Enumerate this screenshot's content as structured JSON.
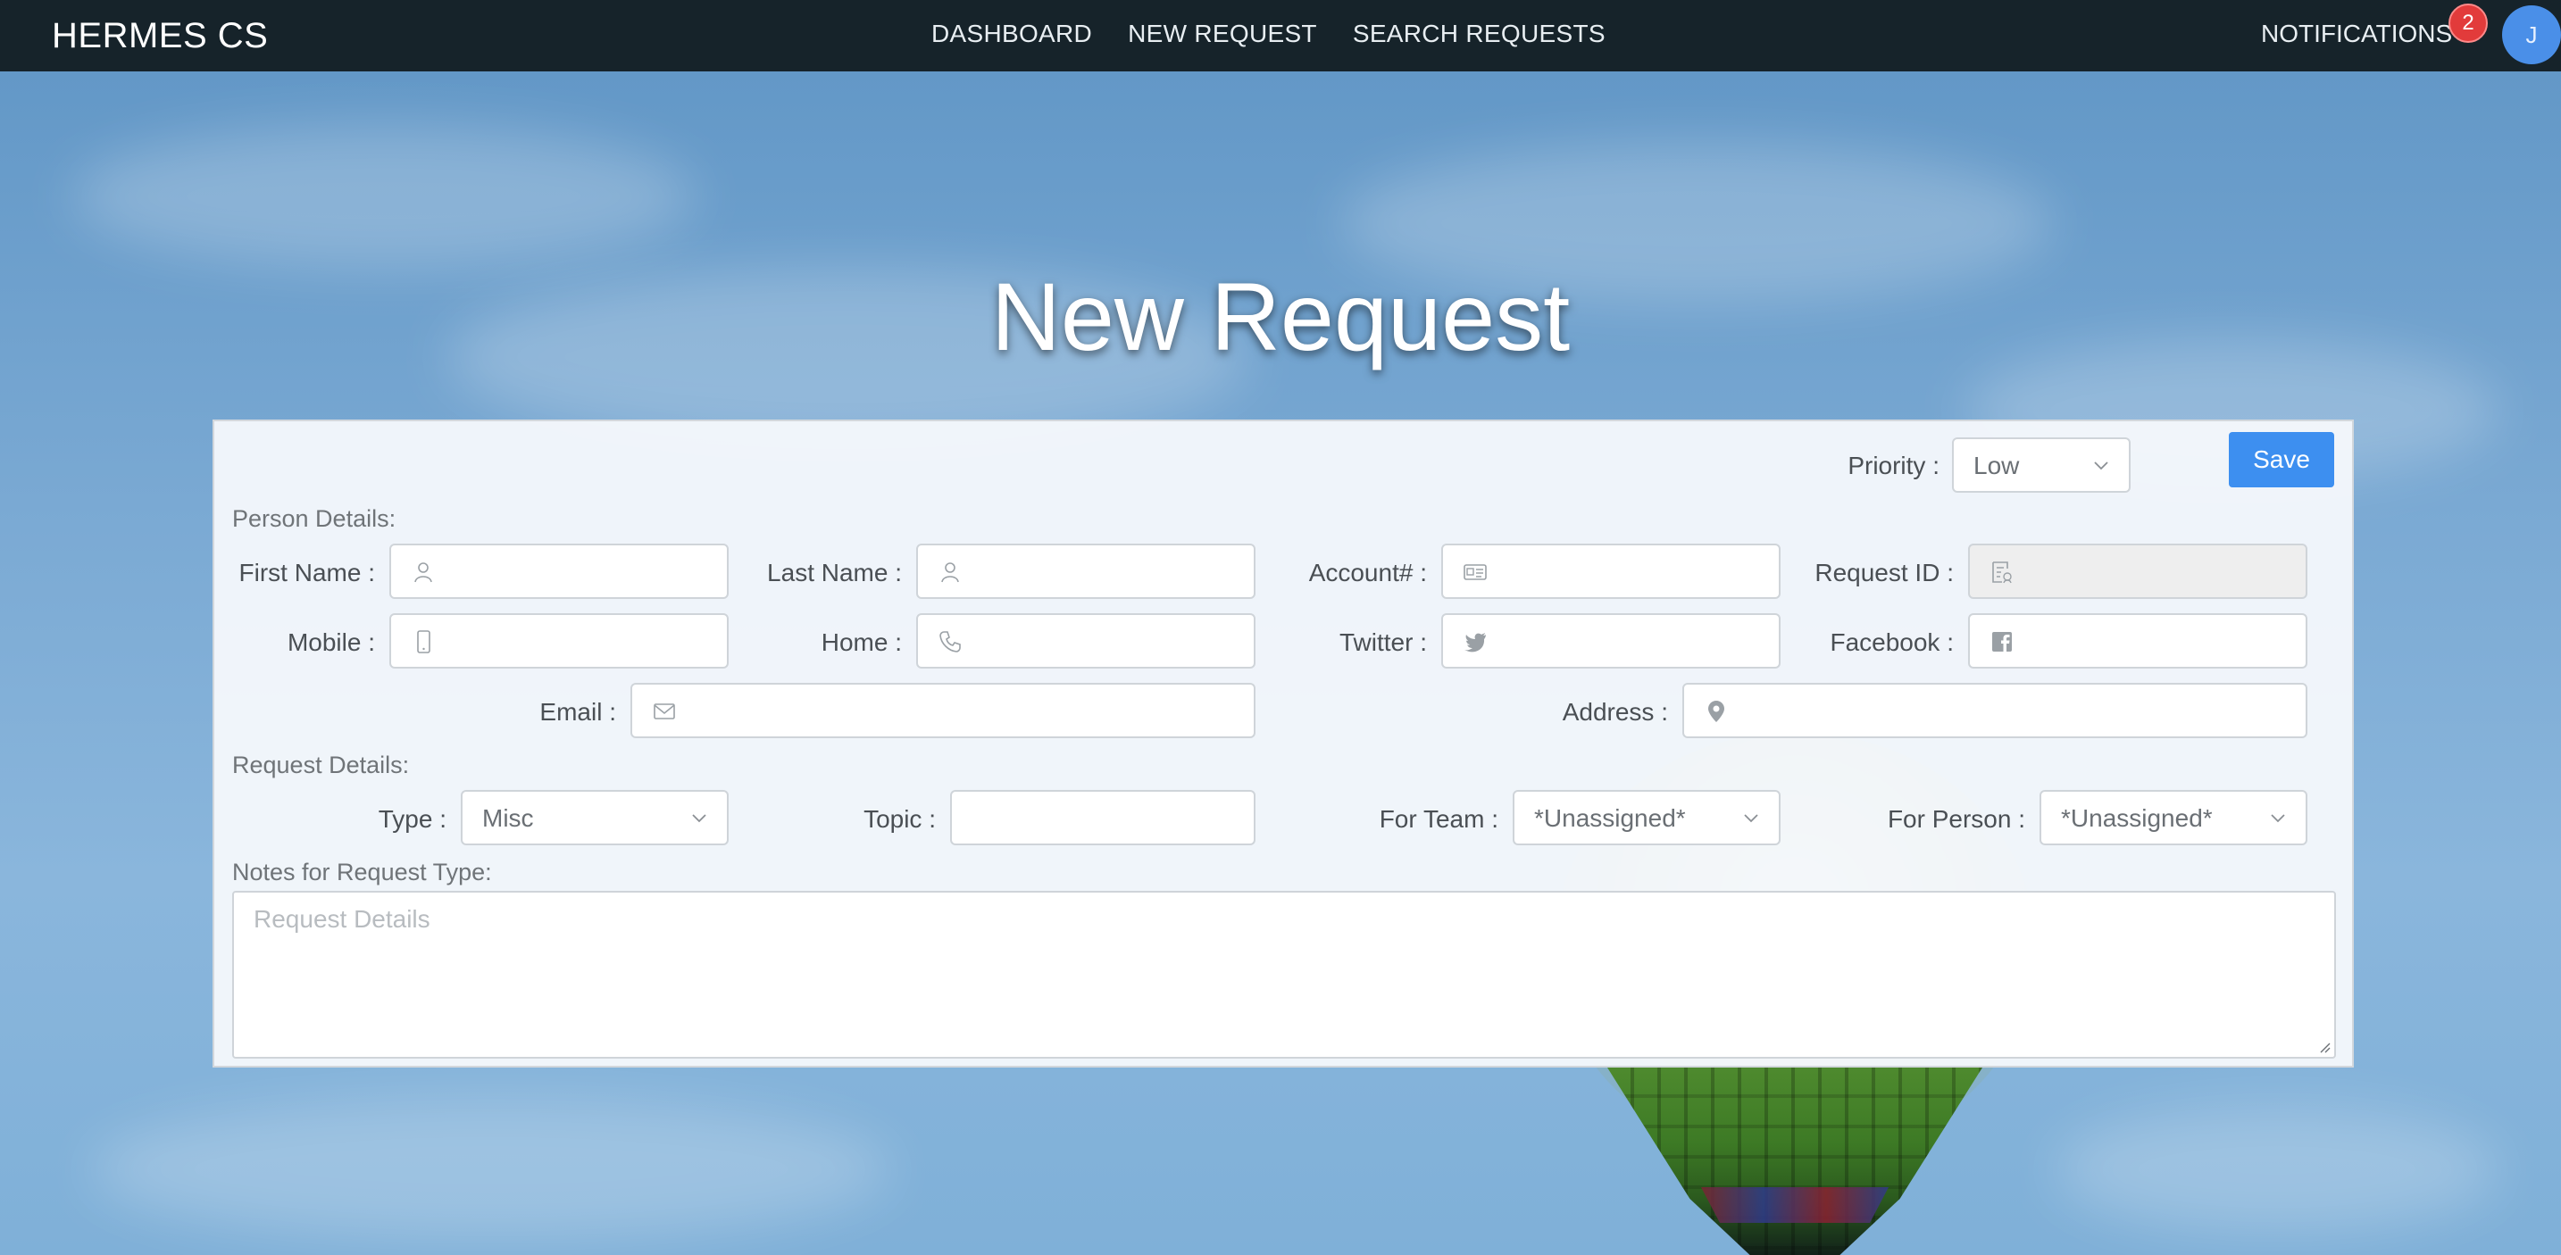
{
  "navbar": {
    "brand": "HERMES CS",
    "links": [
      "DASHBOARD",
      "NEW REQUEST",
      "SEARCH REQUESTS"
    ],
    "notifications_label": "NOTIFICATIONS",
    "notifications_count": "2",
    "avatar_initial": "J"
  },
  "page": {
    "title": "New Request"
  },
  "form": {
    "priority_label": "Priority :",
    "priority_value": "Low",
    "save_label": "Save",
    "person_section": "Person Details:",
    "first_name_label": "First Name :",
    "last_name_label": "Last Name :",
    "account_label": "Account# :",
    "request_id_label": "Request ID :",
    "mobile_label": "Mobile :",
    "home_label": "Home :",
    "twitter_label": "Twitter :",
    "facebook_label": "Facebook :",
    "email_label": "Email :",
    "address_label": "Address :",
    "request_section": "Request Details:",
    "type_label": "Type :",
    "type_value": "Misc",
    "topic_label": "Topic :",
    "for_team_label": "For Team :",
    "for_team_value": "*Unassigned*",
    "for_person_label": "For Person :",
    "for_person_value": "*Unassigned*",
    "notes_label": "Notes for Request Type:",
    "details_placeholder": "Request Details"
  },
  "colors": {
    "navbar_bg": "#16232a",
    "accent": "#3d8ff0",
    "badge": "#e23b3b"
  }
}
